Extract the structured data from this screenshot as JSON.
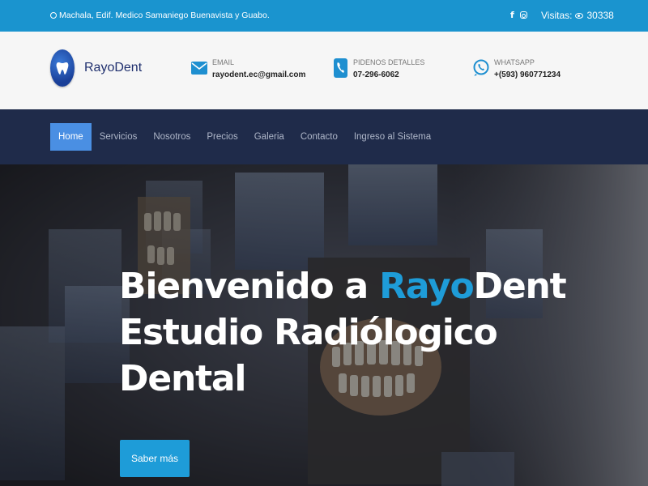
{
  "topbar": {
    "address": "Machala, Edif. Medico Samaniego Buenavista y Guabo.",
    "social": {
      "facebook_icon": "f",
      "instagram_icon": "instagram-icon"
    },
    "visits_label": "Visitas:",
    "visits_count": "30338"
  },
  "header": {
    "logo_text": "RayoDent",
    "contacts": [
      {
        "label": "EMAIL",
        "value": "rayodent.ec@gmail.com",
        "icon": "envelope-icon"
      },
      {
        "label": "PIDENOS DETALLES",
        "value": "07-296-6062",
        "icon": "phone-icon"
      },
      {
        "label": "WHATSAPP",
        "value": "+(593) 960771234",
        "icon": "whatsapp-icon"
      }
    ]
  },
  "nav": {
    "items": [
      {
        "label": "Home"
      },
      {
        "label": "Servicios"
      },
      {
        "label": "Nosotros"
      },
      {
        "label": "Precios"
      },
      {
        "label": "Galeria"
      },
      {
        "label": "Contacto"
      },
      {
        "label": "Ingreso al Sistema"
      }
    ]
  },
  "hero": {
    "title_part1": "Bienvenido a ",
    "title_brand1": "Rayo",
    "title_brand2": "Dent",
    "title_line2": "Estudio Radiólogico",
    "title_line3": "Dental",
    "button_label": "Saber más"
  },
  "colors": {
    "topbar": "#1a94cf",
    "nav": "#1f2b4a",
    "nav_active": "#4a8fe3",
    "accent": "#1e9cd8"
  }
}
